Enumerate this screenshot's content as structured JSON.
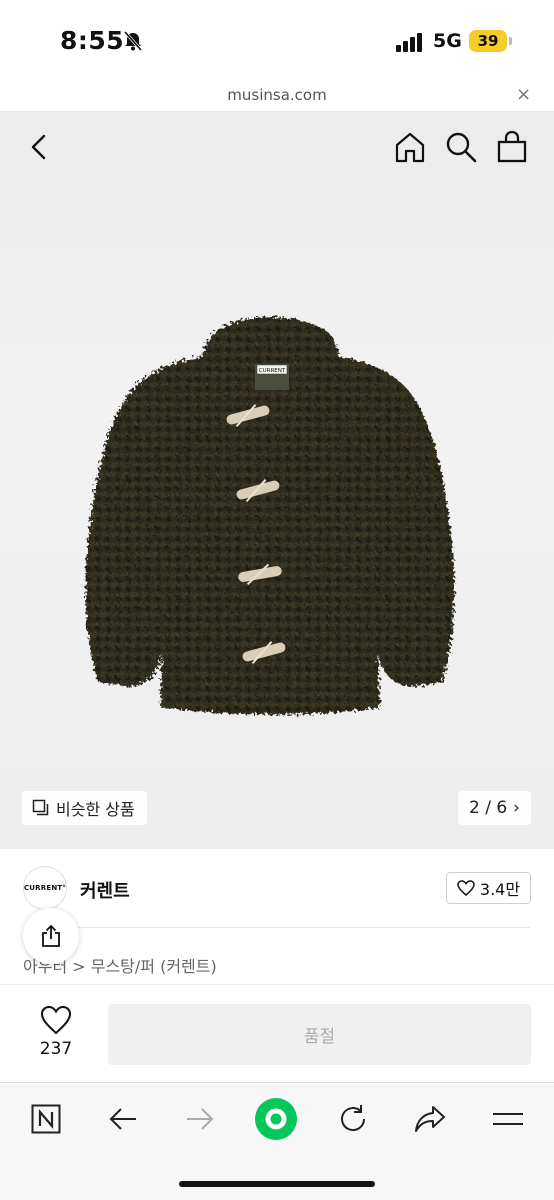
{
  "status_bar": {
    "time": "8:55",
    "network": "5G",
    "battery": "39",
    "icons": [
      "bell-slash-icon",
      "signal-icon"
    ]
  },
  "browser": {
    "url": "musinsa.com",
    "close_symbol": "×"
  },
  "product": {
    "image_description_icons": [
      "back-arrow-icon",
      "home-icon",
      "search-icon",
      "shopping-bag-icon"
    ],
    "similar_label": "비슷한 상품",
    "page_indicator": "2 / 6",
    "page_chevron": "›",
    "tag_label": "CURRENT"
  },
  "brand": {
    "logo_text": "CURRENT°",
    "name": "커렌트",
    "likes": "3.4만"
  },
  "category": {
    "path": "아우터 > 무스탕/퍼 (커렌트)"
  },
  "purchase": {
    "wish_count": "237",
    "button_label": "품절"
  },
  "toolbar": {
    "items": [
      "naver-icon",
      "back-icon",
      "forward-icon",
      "green-dot-icon",
      "reload-icon",
      "share-icon",
      "menu-icon"
    ]
  },
  "colors": {
    "soldout_bg": "#f0f0f0",
    "battery": "#f5cc2a",
    "green_button": "#03c75a",
    "coat": "#2b2a1c"
  }
}
